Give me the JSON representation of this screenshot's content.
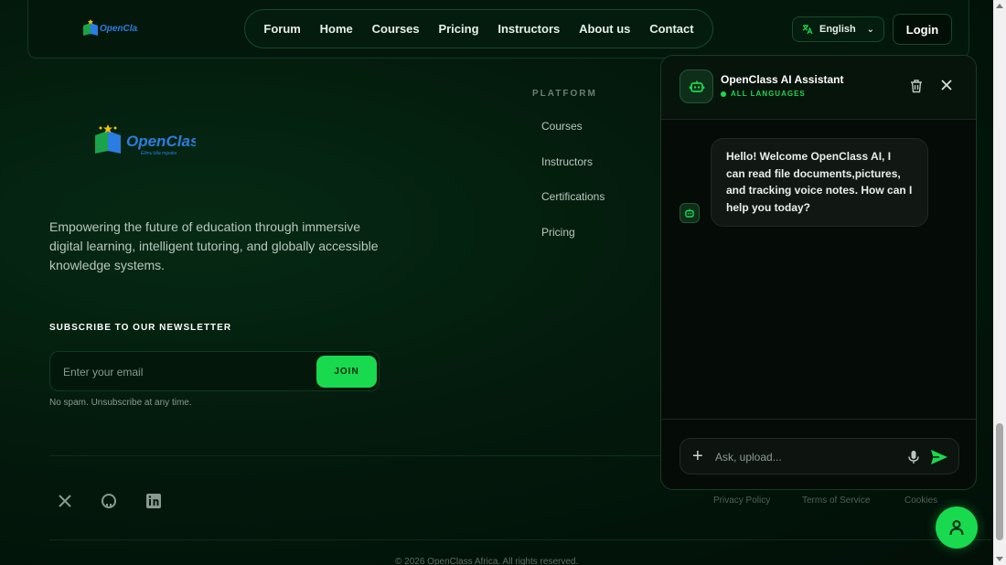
{
  "header": {
    "brand": "OpenClass",
    "nav": [
      "Forum",
      "Home",
      "Courses",
      "Pricing",
      "Instructors",
      "About us",
      "Contact"
    ],
    "language": "English",
    "login": "Login"
  },
  "footer": {
    "brand": "OpenClass",
    "brand_slogan": "Elimu bila mipaka",
    "tagline": "Empowering the future of education through immersive digital learning, intelligent tutoring, and globally accessible knowledge systems.",
    "newsletter": {
      "title": "SUBSCRIBE TO OUR NEWSLETTER",
      "placeholder": "Enter your email",
      "button": "JOIN",
      "note": "No spam. Unsubscribe at any time."
    },
    "platform": {
      "title": "PLATFORM",
      "links": [
        "Courses",
        "Instructors",
        "Certifications",
        "Pricing"
      ]
    },
    "social": [
      "x-icon",
      "github-icon",
      "linkedin-icon"
    ],
    "legal": [
      "Privacy Policy",
      "Terms of Service",
      "Cookies"
    ],
    "copyright": "© 2026 OpenClass Africa. All rights reserved."
  },
  "chat": {
    "title": "OpenClass AI Assistant",
    "status": "ALL LANGUAGES",
    "message": "Hello! Welcome OpenClass AI, I can read file documents,pictures, and tracking voice notes. How can I help you today?",
    "input_placeholder": "Ask, upload..."
  },
  "colors": {
    "accent": "#19d94f",
    "background": "#031a0c"
  }
}
